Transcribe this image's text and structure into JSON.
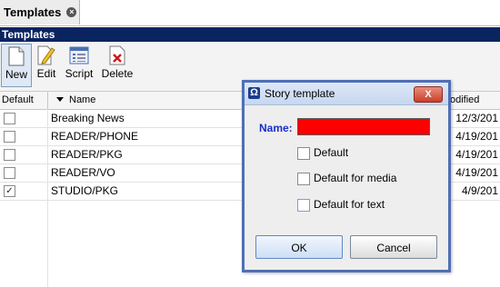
{
  "tab": {
    "label": "Templates",
    "close": "×"
  },
  "panel": {
    "title": "Templates"
  },
  "toolbar": {
    "new_label": "New",
    "edit_label": "Edit",
    "script_label": "Script",
    "delete_label": "Delete"
  },
  "table": {
    "columns": {
      "default": "Default",
      "name": "Name",
      "modified": "odified"
    },
    "rows": [
      {
        "checked": false,
        "name": "Breaking News",
        "modified": "12/3/201"
      },
      {
        "checked": false,
        "name": "READER/PHONE",
        "modified": "4/19/201"
      },
      {
        "checked": false,
        "name": "READER/PKG",
        "modified": "4/19/201"
      },
      {
        "checked": false,
        "name": "READER/VO",
        "modified": "4/19/201"
      },
      {
        "checked": true,
        "name": "STUDIO/PKG",
        "modified": "4/9/201"
      }
    ]
  },
  "dialog": {
    "title": "Story template",
    "name_label": "Name:",
    "name_value": "",
    "options": [
      {
        "label": "Default",
        "checked": false
      },
      {
        "label": "Default for media",
        "checked": false
      },
      {
        "label": "Default for text",
        "checked": false
      }
    ],
    "ok_label": "OK",
    "cancel_label": "Cancel",
    "close": "X",
    "app_icon": "Ω"
  },
  "colors": {
    "title_bar": "#0a2460",
    "name_field": "#ff0000",
    "name_label": "#1b2fc8",
    "dialog_border": "#4f6fb6"
  }
}
